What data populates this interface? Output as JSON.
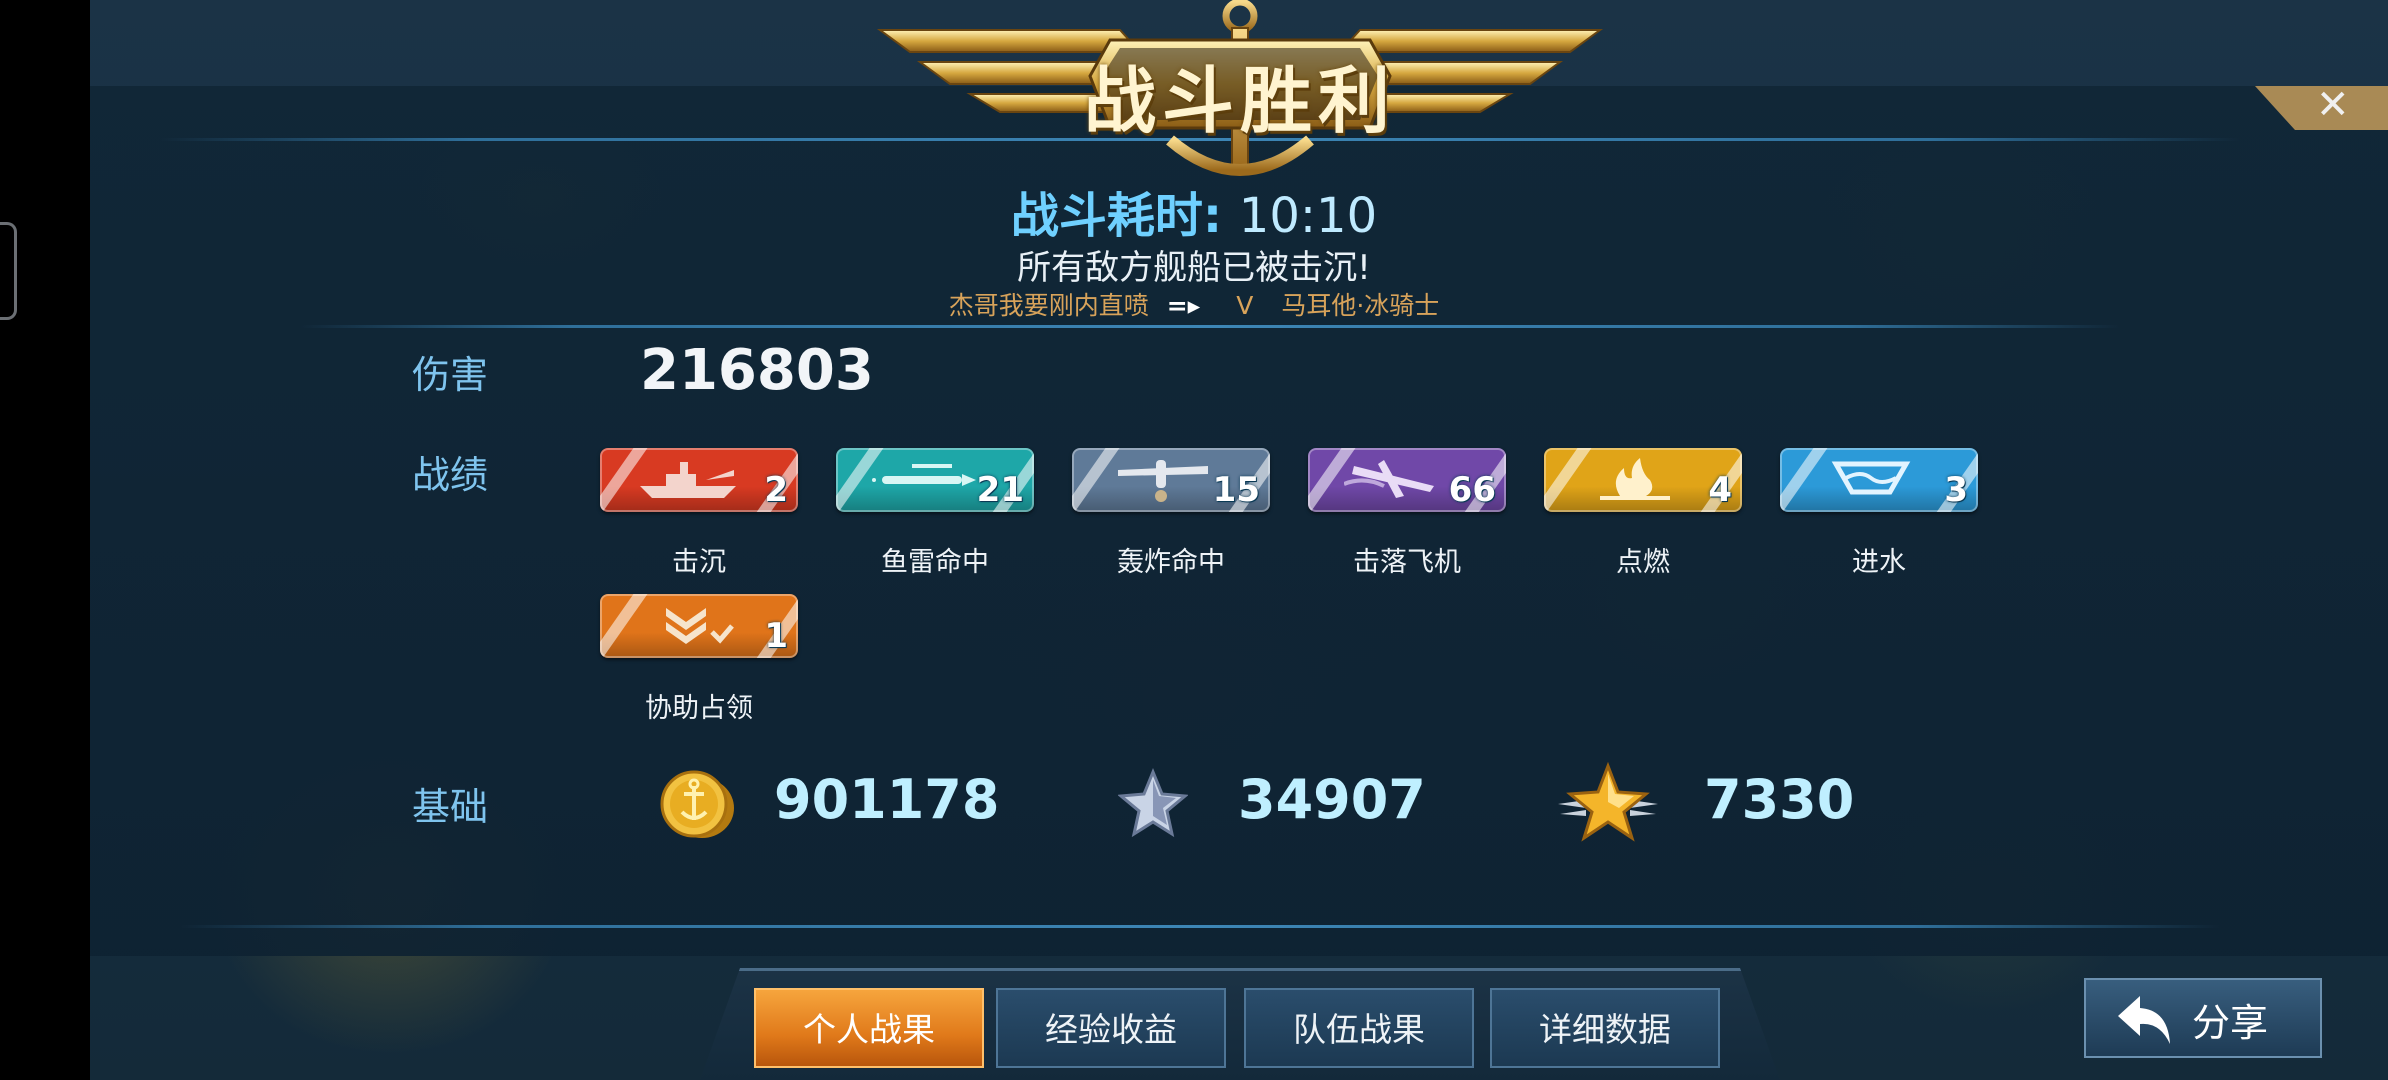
{
  "header": {
    "title": "战斗胜利"
  },
  "battle": {
    "duration_label": "战斗耗时:",
    "duration_value": "10:10",
    "message": "所有敌方舰船已被击沉!",
    "kill_feed": {
      "killer": "杰哥我要刚内直喷",
      "separator": "V",
      "victim": "马耳他·冰骑士"
    }
  },
  "damage": {
    "label": "伤害",
    "value": "216803"
  },
  "record": {
    "label": "战绩",
    "medals": [
      {
        "name": "击沉",
        "count": "2",
        "color": "#d83a22",
        "icon": "ship-icon"
      },
      {
        "name": "鱼雷命中",
        "count": "21",
        "color": "#1ea7a8",
        "icon": "torpedo-icon"
      },
      {
        "name": "轰炸命中",
        "count": "15",
        "color": "#5f7a98",
        "icon": "bomber-icon"
      },
      {
        "name": "击落飞机",
        "count": "66",
        "color": "#7048a8",
        "icon": "plane-down-icon"
      },
      {
        "name": "点燃",
        "count": "4",
        "color": "#e0a418",
        "icon": "fire-icon"
      },
      {
        "name": "进水",
        "count": "3",
        "color": "#2c9ad8",
        "icon": "flood-icon"
      },
      {
        "name": "协助占领",
        "count": "1",
        "color": "#e0741a",
        "icon": "capture-icon"
      }
    ]
  },
  "base": {
    "label": "基础",
    "coins": "901178",
    "exp": "34907",
    "rank": "7330"
  },
  "tabs": [
    "个人战果",
    "经验收益",
    "队伍战果",
    "详细数据"
  ],
  "share_label": "分享"
}
